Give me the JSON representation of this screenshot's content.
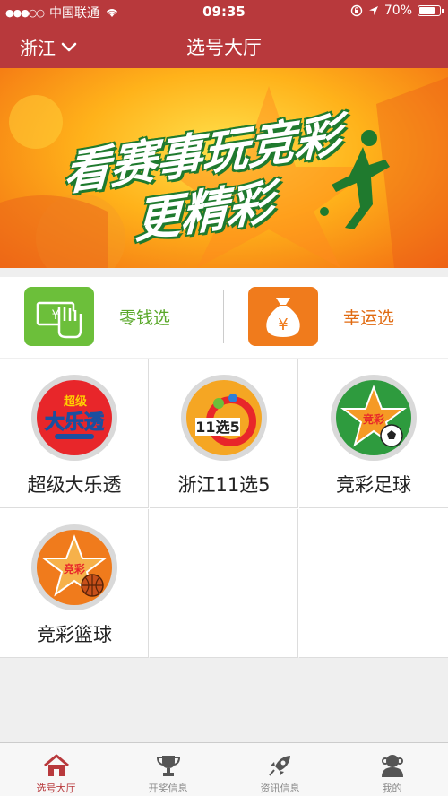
{
  "status_bar": {
    "carrier": "中国联通",
    "time": "09:35",
    "battery": "70%",
    "signal_dots": "●●●○○",
    "icons": [
      "wifi-icon",
      "rotation-lock-icon",
      "location-icon",
      "battery-icon"
    ]
  },
  "navbar": {
    "region": "浙江",
    "title": "选号大厅"
  },
  "banner": {
    "line1": "看赛事玩竞彩",
    "line2": "更精彩"
  },
  "quick_pick": {
    "left": {
      "label": "零钱选",
      "icon": "cash-hand-icon",
      "color": "#6cbf3a"
    },
    "right": {
      "label": "幸运选",
      "icon": "money-bag-icon",
      "color": "#f07b1c"
    }
  },
  "games": [
    {
      "name": "超级大乐透",
      "logo_text": "大乐透",
      "logo_sub": "超级"
    },
    {
      "name": "浙江11选5",
      "logo_text": "11选5"
    },
    {
      "name": "竞彩足球",
      "logo_text": "竞彩"
    },
    {
      "name": "竞彩篮球",
      "logo_text": "竞彩"
    }
  ],
  "tabs": [
    {
      "label": "选号大厅",
      "icon": "home-icon",
      "active": true
    },
    {
      "label": "开奖信息",
      "icon": "trophy-icon",
      "active": false
    },
    {
      "label": "资讯信息",
      "icon": "rocket-icon",
      "active": false
    },
    {
      "label": "我的",
      "icon": "user-icon",
      "active": false
    }
  ],
  "colors": {
    "brand_red": "#b8393c",
    "green": "#6cbf3a",
    "orange": "#f07b1c"
  }
}
